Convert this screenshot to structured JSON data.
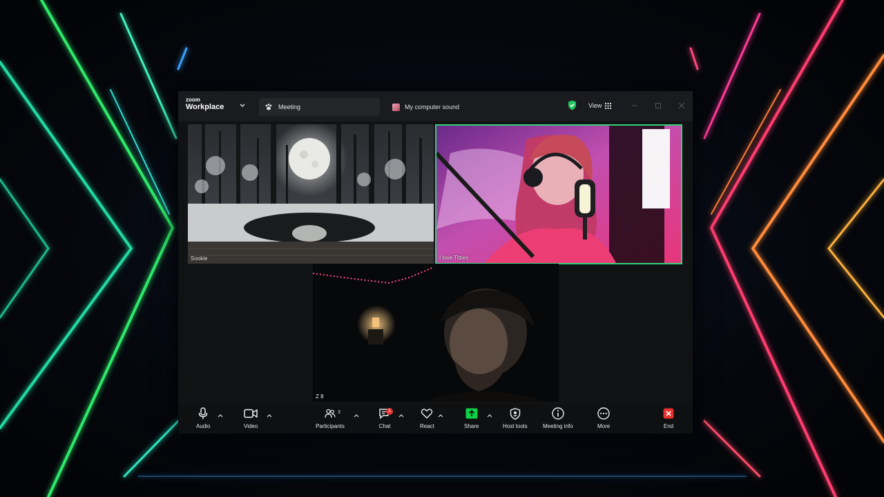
{
  "window": {
    "logo_small": "zoom",
    "logo_big": "Workplace",
    "tabs": [
      {
        "label": "Meeting",
        "icon": "paw-icon"
      },
      {
        "label": "My computer sound",
        "icon": "app-icon"
      }
    ],
    "view_label": "View"
  },
  "participants": [
    {
      "name": "Sookie",
      "video": "snowy-forest-moon"
    },
    {
      "name": "I love Titties",
      "video": "pink-streamer-with-microphone",
      "active_speaker": true,
      "highlight_color": "#2fd47a"
    },
    {
      "name": "Z 8",
      "video": "dark-room-man"
    }
  ],
  "toolbar": {
    "audio": "Audio",
    "video": "Video",
    "participants": "Participants",
    "participants_count": "3",
    "chat": "Chat",
    "chat_badge": "1",
    "react": "React",
    "share": "Share",
    "host_tools": "Host tools",
    "meeting_info": "Meeting info",
    "more": "More",
    "end": "End"
  },
  "colors": {
    "share_green": "#0ed145",
    "end_red": "#e5322d",
    "badge_red": "#e5322d",
    "shield_green": "#22c55e"
  }
}
